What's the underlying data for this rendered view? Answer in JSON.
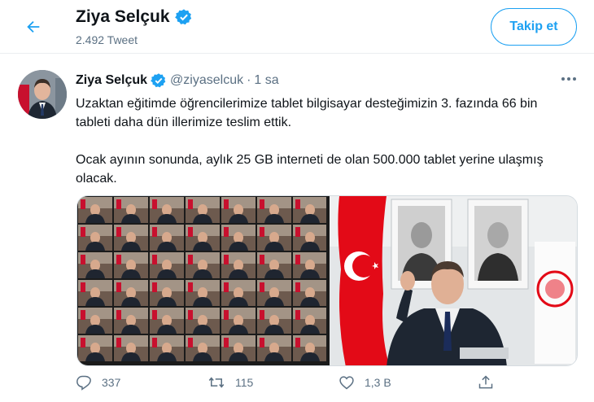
{
  "header": {
    "back_icon": "arrow-left-icon",
    "name": "Ziya Selçuk",
    "verified_icon": "verified-badge-icon",
    "tweet_count": "2.492 Tweet",
    "follow_label": "Takip et"
  },
  "tweet": {
    "author_name": "Ziya Selçuk",
    "handle": "@ziyaselcuk",
    "separator": "·",
    "time": "1 sa",
    "more_icon": "more-horizontal-icon",
    "text_paragraphs": [
      "Uzaktan eğitimde öğrencilerimize tablet bilgisayar desteğimizin 3. fazında 66 bin tableti daha dün illerimize teslim ettik.",
      "Ocak ayının sonunda, aylık 25 GB interneti de olan 500.000 tablet yerine ulaşmış olacak."
    ],
    "media": {
      "description_icon": "video-conference-photo"
    },
    "actions": {
      "reply_icon": "reply-icon",
      "reply_count": "337",
      "retweet_icon": "retweet-icon",
      "retweet_count": "115",
      "like_icon": "heart-icon",
      "like_count": "1,3 B",
      "share_icon": "share-icon"
    }
  },
  "colors": {
    "accent": "#1da1f2",
    "secondary_text": "#5b7083",
    "border": "#ebeef0",
    "flag_red": "#e30a17"
  }
}
